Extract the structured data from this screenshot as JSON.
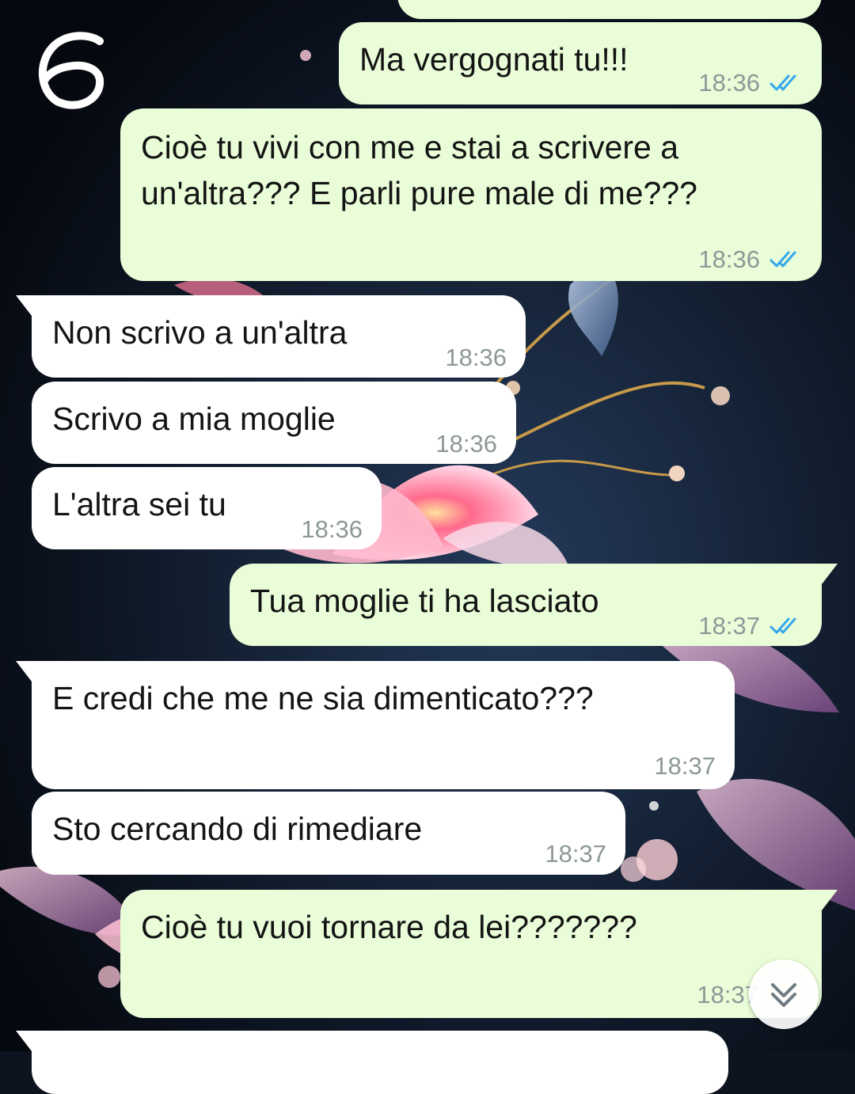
{
  "overlay": {
    "page_number": "6"
  },
  "colors": {
    "outgoing_bubble": "#e9fdd8",
    "incoming_bubble": "#ffffff",
    "read_ticks": "#34a8ec",
    "timestamp": "#8e9898"
  },
  "messages": [
    {
      "direction": "out",
      "text": "",
      "time": "",
      "status": "read"
    },
    {
      "direction": "out",
      "text": "Ma vergognati tu!!!",
      "time": "18:36",
      "status": "read"
    },
    {
      "direction": "out",
      "text": "Cioè tu vivi con me e stai a scrivere a\nun'altra??? E parli pure male di me???",
      "time": "18:36",
      "status": "read"
    },
    {
      "direction": "in",
      "text": "Non scrivo a un'altra",
      "time": "18:36"
    },
    {
      "direction": "in",
      "text": "Scrivo a mia moglie",
      "time": "18:36"
    },
    {
      "direction": "in",
      "text": "L'altra sei tu",
      "time": "18:36"
    },
    {
      "direction": "out",
      "text": "Tua moglie ti ha lasciato",
      "time": "18:37",
      "status": "read"
    },
    {
      "direction": "in",
      "text": "E credi che me ne sia dimenticato???",
      "time": "18:37"
    },
    {
      "direction": "in",
      "text": "Sto cercando di rimediare",
      "time": "18:37"
    },
    {
      "direction": "out",
      "text": "Cioè tu vuoi tornare da lei???????",
      "time": "18:37",
      "status": "read"
    },
    {
      "direction": "in",
      "text": "",
      "time": ""
    }
  ],
  "scroll_button": {
    "icon": "chevron-double-down-icon"
  }
}
